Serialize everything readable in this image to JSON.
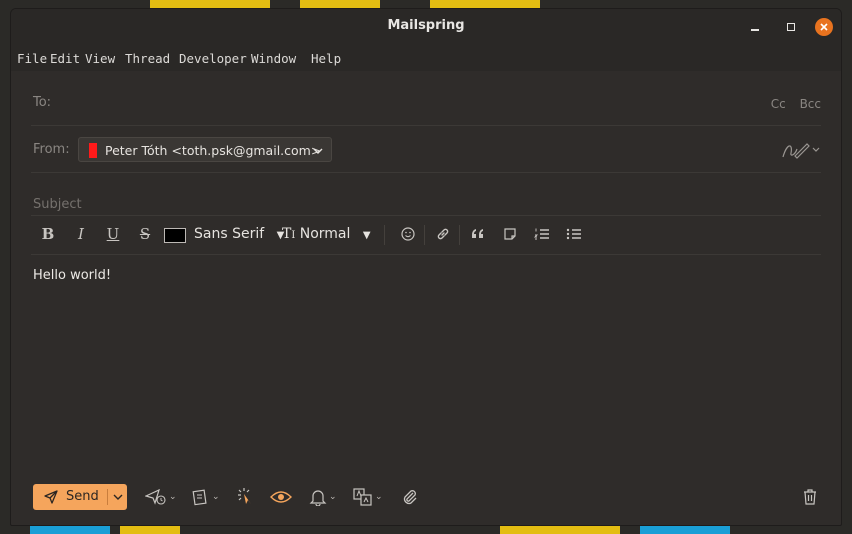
{
  "window": {
    "title": "Mailspring"
  },
  "menu": [
    "File",
    "Edit",
    "View",
    "Thread",
    "Developer",
    "Window",
    "Help"
  ],
  "compose": {
    "to_label": "To:",
    "cc_label": "Cc",
    "bcc_label": "Bcc",
    "from_label": "From:",
    "from_account": "Peter Tóth <toth.psk@gmail.com>",
    "account_color": "#ff1a1a",
    "subject_placeholder": "Subject",
    "body": "Hello world!"
  },
  "toolbar": {
    "bold": "B",
    "italic": "I",
    "underline": "U",
    "strike": "S",
    "text_color": "#000000",
    "font_family": "Sans Serif",
    "font_size": "Normal",
    "icons": [
      "emoji-icon",
      "link-icon",
      "quote-icon",
      "note-icon",
      "numbered-list-icon",
      "bullet-list-icon"
    ]
  },
  "bottom": {
    "send_label": "Send",
    "accent_color": "#f5a55c",
    "icons": [
      "send-later-icon",
      "templates-icon",
      "link-tracking-icon",
      "open-tracking-icon",
      "reminder-icon",
      "translate-icon",
      "attachment-icon",
      "trash-icon"
    ]
  }
}
